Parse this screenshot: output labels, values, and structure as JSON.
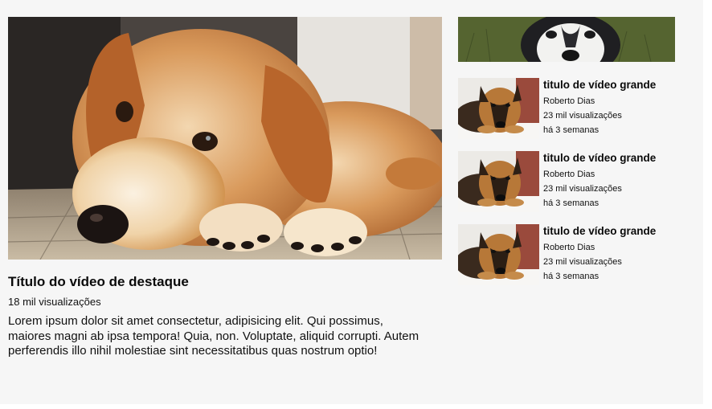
{
  "featured": {
    "thumbnail_alt": "golden-retriever-puppy-image",
    "title": "Título do vídeo de destaque",
    "views": "18 mil visualizações",
    "description": "Lorem ipsum dolor sit amet consectetur, adipisicing elit. Qui possimus, maiores magni ab ipsa tempora! Quia, non. Voluptate, aliquid corrupti. Autem perferendis illo nihil molestiae sint necessitatibus quas nostrum optio!"
  },
  "sidebar": {
    "top_thumbnail_alt": "husky-image",
    "videos": [
      {
        "title": "titulo de vídeo grande",
        "author": "Roberto Dias",
        "views": "23 mil visualizações",
        "age": "há 3 semanas"
      },
      {
        "title": "titulo de vídeo grande",
        "author": "Roberto Dias",
        "views": "23 mil visualizações",
        "age": "há 3 semanas"
      },
      {
        "title": "titulo de vídeo grande",
        "author": "Roberto Dias",
        "views": "23 mil visualizações",
        "age": "há 3 semanas"
      }
    ]
  },
  "colors": {
    "page_background": "#f6f6f6",
    "text": "#0a0a0a"
  }
}
